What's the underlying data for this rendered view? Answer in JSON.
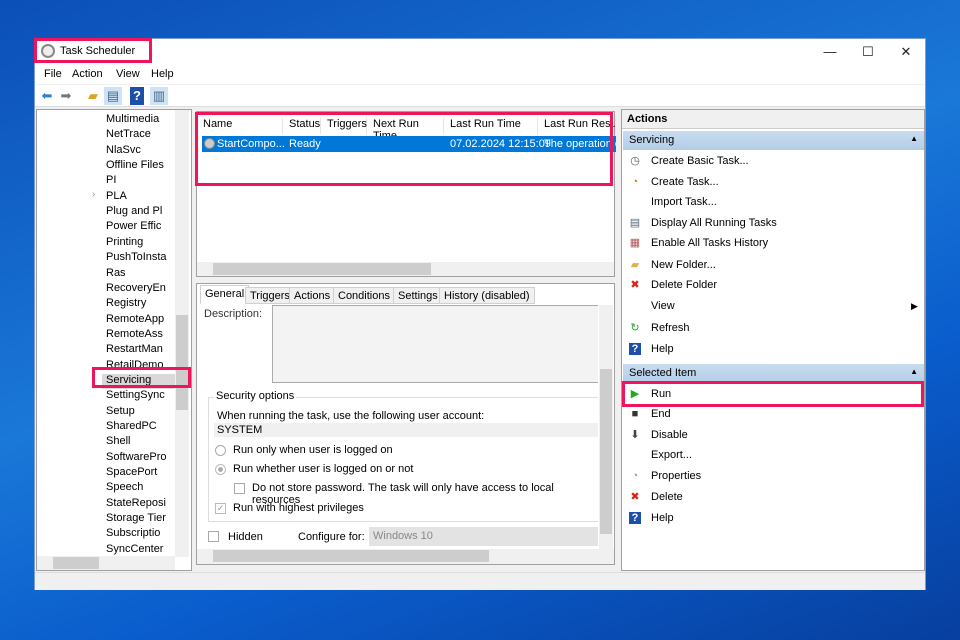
{
  "window": {
    "title": "Task Scheduler",
    "controls": [
      "—",
      "☐",
      "✕"
    ]
  },
  "menu": [
    "File",
    "Action",
    "View",
    "Help"
  ],
  "tree": {
    "items": [
      "Multimedia",
      "NetTrace",
      "NlaSvc",
      "Offline Files",
      "PI",
      "PLA",
      "Plug and Pl",
      "Power Effic",
      "Printing",
      "PushToInsta",
      "Ras",
      "RecoveryEn",
      "Registry",
      "RemoteApp",
      "RemoteAss",
      "RestartMan",
      "RetailDemo",
      "Servicing",
      "SettingSync",
      "Setup",
      "SharedPC",
      "Shell",
      "SoftwarePro",
      "SpacePort",
      "Speech",
      "StateReposi",
      "Storage Tier",
      "Subscriptio",
      "SyncCenter"
    ],
    "selected": "Servicing"
  },
  "task_list": {
    "columns": [
      "Name",
      "Status",
      "Triggers",
      "Next Run Time",
      "Last Run Time",
      "Last Run Result"
    ],
    "rows": [
      {
        "name": "StartCompo...",
        "status": "Ready",
        "triggers": "",
        "next_run": "",
        "last_run": "07.02.2024 12:15:09",
        "result": "The operation c"
      }
    ]
  },
  "detail": {
    "tabs": [
      "General",
      "Triggers",
      "Actions",
      "Conditions",
      "Settings",
      "History (disabled)"
    ],
    "active_tab": "General",
    "description_label": "Description:",
    "security_title": "Security options",
    "account_prompt": "When running the task, use the following user account:",
    "account": "SYSTEM",
    "radio_logged_on": "Run only when user is logged on",
    "radio_whether": "Run whether user is logged on or not",
    "no_store_pw": "Do not store password.  The task will only have access to local resources",
    "highest": "Run with highest privileges",
    "hidden": "Hidden",
    "configure_label": "Configure for:",
    "configure_value": "Windows 10"
  },
  "actions": {
    "header": "Actions",
    "section1": "Servicing",
    "items1": [
      "Create Basic Task...",
      "Create Task...",
      "Import Task...",
      "Display All Running Tasks",
      "Enable All Tasks History",
      "New Folder...",
      "Delete Folder",
      "View",
      "Refresh",
      "Help"
    ],
    "section2": "Selected Item",
    "items2": [
      "Run",
      "End",
      "Disable",
      "Export...",
      "Properties",
      "Delete",
      "Help"
    ]
  }
}
